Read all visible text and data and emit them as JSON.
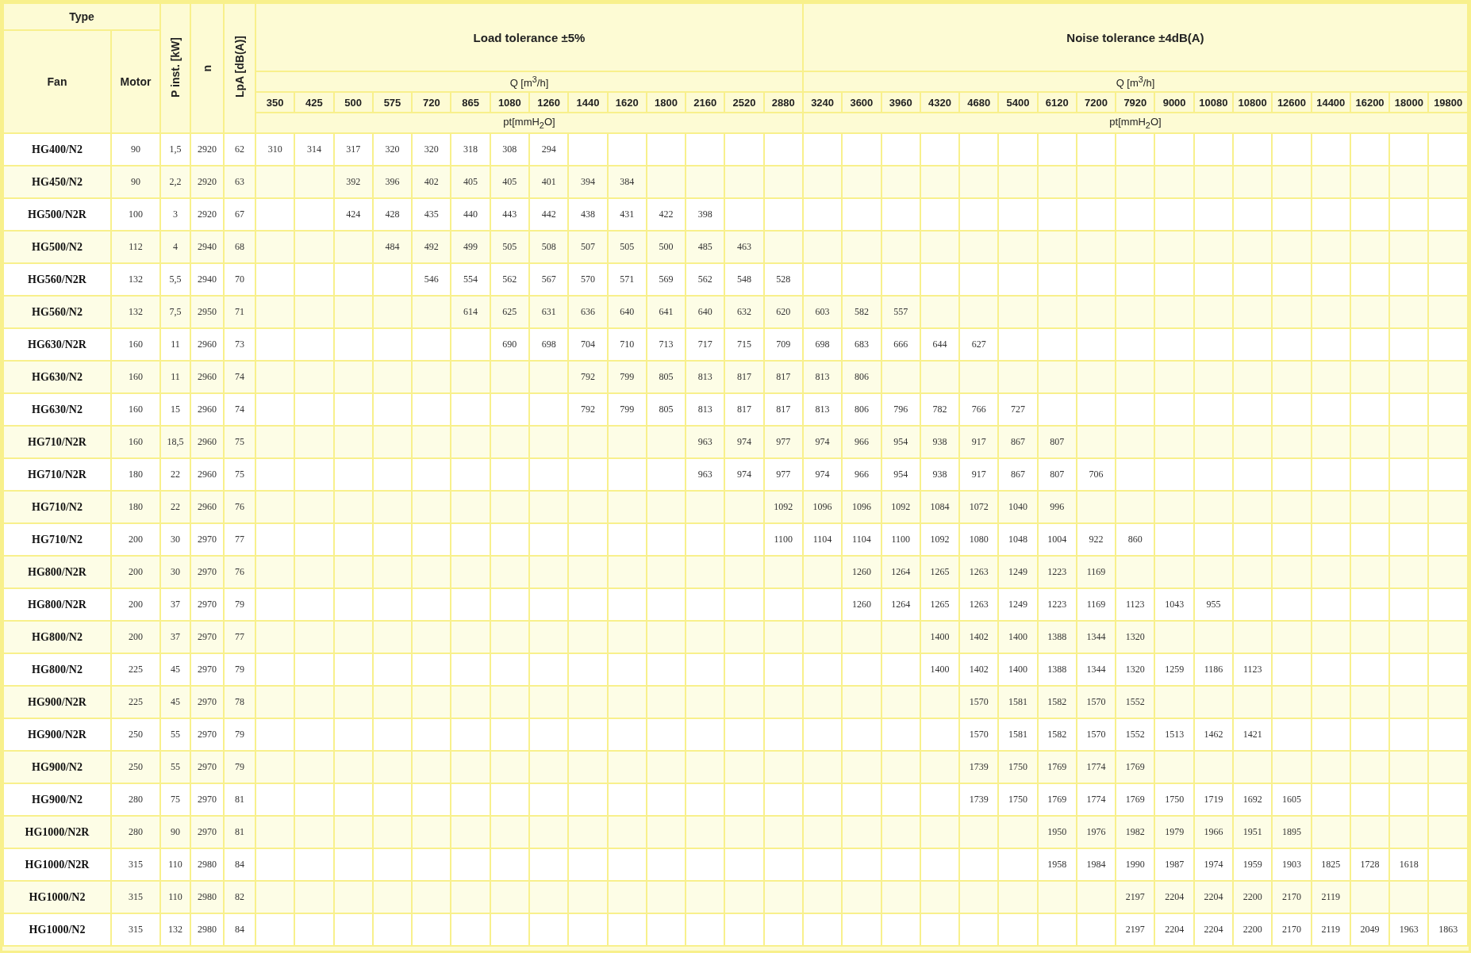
{
  "header": {
    "type": "Type",
    "fan": "Fan",
    "motor": "Motor",
    "p_inst": "P inst. [kW]",
    "n": "n",
    "lpa": "LpA [dB(A)]",
    "groups": [
      {
        "title": "Load tolerance ±5%",
        "q_label": "Q [m$^{3}$/h]",
        "pt_label": "pt[mmH$_{2}$O]",
        "q_values": [
          "350",
          "425",
          "500",
          "575",
          "720",
          "865",
          "1080",
          "1260",
          "1440",
          "1620",
          "1800",
          "2160",
          "2520",
          "2880"
        ]
      },
      {
        "title": "Noise tolerance ±4dB(A)",
        "q_label": "Q [m$^{3}$/h]",
        "pt_label": "pt[mmH$_{2}$O]",
        "q_values": [
          "3240",
          "3600",
          "3960",
          "4320",
          "4680",
          "5400",
          "6120",
          "7200",
          "7920",
          "9000",
          "10080",
          "10800",
          "12600",
          "14400",
          "16200",
          "18000",
          "19800"
        ]
      }
    ]
  },
  "rows": [
    {
      "fan": "HG400/N2",
      "motor": "90",
      "p_inst": "1,5",
      "n": "2920",
      "lpa": "62",
      "lead_blanks": [],
      "pt": [
        "310",
        "314",
        "317",
        "320",
        "320",
        "318",
        "308",
        "294"
      ]
    },
    {
      "fan": "HG450/N2",
      "motor": "90",
      "p_inst": "2,2",
      "n": "2920",
      "lpa": "63",
      "lead_blanks": [
        {
          "kind": "blank"
        },
        {
          "kind": "blank"
        }
      ],
      "pt": [
        "392",
        "396",
        "402",
        "405",
        "405",
        "401",
        "394",
        "384"
      ]
    },
    {
      "fan": "HG500/N2R",
      "motor": "100",
      "p_inst": "3",
      "n": "2920",
      "lpa": "67",
      "lead_blanks": [
        {
          "kind": "blank"
        },
        {
          "kind": "blank"
        }
      ],
      "pt": [
        "424",
        "428",
        "435",
        "440",
        "443",
        "442",
        "438",
        "431",
        "422",
        "398"
      ]
    },
    {
      "fan": "HG500/N2",
      "motor": "112",
      "p_inst": "4",
      "n": "2940",
      "lpa": "68",
      "lead_blanks": [
        {
          "kind": "blank"
        },
        {
          "kind": "blank"
        },
        {
          "kind": "blank"
        }
      ],
      "pt": [
        "484",
        "492",
        "499",
        "505",
        "508",
        "507",
        "505",
        "500",
        "485",
        "463"
      ]
    },
    {
      "fan": "HG560/N2R",
      "motor": "132",
      "p_inst": "5,5",
      "n": "2940",
      "lpa": "70",
      "lead_blanks": [
        {
          "kind": "blank"
        },
        {
          "kind": "blank"
        },
        {
          "kind": "blank"
        },
        {
          "kind": "blank"
        }
      ],
      "pt": [
        "546",
        "554",
        "562",
        "567",
        "570",
        "571",
        "569",
        "562",
        "548",
        "528"
      ]
    },
    {
      "fan": "HG560/N2",
      "motor": "132",
      "p_inst": "7,5",
      "n": "2950",
      "lpa": "71",
      "lead_blanks": [
        {
          "kind": "blank"
        },
        {
          "kind": "blank"
        },
        {
          "kind": "blank"
        },
        {
          "kind": "blank"
        },
        {
          "kind": "blank"
        }
      ],
      "pt": [
        "614",
        "625",
        "631",
        "636",
        "640",
        "641",
        "640",
        "632",
        "620",
        "603",
        "582",
        "557"
      ]
    },
    {
      "fan": "HG630/N2R",
      "motor": "160",
      "p_inst": "11",
      "n": "2960",
      "lpa": "73",
      "lead_blanks": [
        {
          "kind": "blank"
        },
        {
          "kind": "blank"
        },
        {
          "kind": "blank"
        },
        {
          "kind": "blank"
        },
        {
          "kind": "blank"
        },
        {
          "kind": "blank"
        }
      ],
      "pt": [
        "690",
        "698",
        "704",
        "710",
        "713",
        "717",
        "715",
        "709",
        "698",
        "683",
        "666",
        "644",
        "627"
      ]
    },
    {
      "fan": "HG630/N2",
      "motor": "160",
      "p_inst": "11",
      "n": "2960",
      "lpa": "74",
      "lead_blanks": [
        {
          "kind": "blank"
        },
        {
          "kind": "blank"
        },
        {
          "kind": "blank"
        },
        {
          "kind": "blank"
        },
        {
          "kind": "blank"
        },
        {
          "kind": "blank"
        },
        {
          "kind": "blank"
        },
        {
          "kind": "blank"
        }
      ],
      "pt": [
        "792",
        "799",
        "805",
        "813",
        "817",
        "817",
        "813",
        "806"
      ]
    },
    {
      "fan": "HG630/N2",
      "motor": "160",
      "p_inst": "15",
      "n": "2960",
      "lpa": "74",
      "lead_blanks": [
        {
          "kind": "blank"
        },
        {
          "kind": "blank"
        },
        {
          "kind": "blank"
        },
        {
          "kind": "blank"
        },
        {
          "kind": "blank"
        },
        {
          "kind": "blank"
        },
        {
          "kind": "blank"
        },
        {
          "kind": "blank"
        }
      ],
      "pt": [
        "792",
        "799",
        "805",
        "813",
        "817",
        "817",
        "813",
        "806",
        "796",
        "782",
        "766",
        "727"
      ]
    },
    {
      "fan": "HG710/N2R",
      "motor": "160",
      "p_inst": "18,5",
      "n": "2960",
      "lpa": "75",
      "lead_blanks": [
        {
          "kind": "blank"
        },
        {
          "kind": "blank"
        },
        {
          "kind": "blank"
        },
        {
          "kind": "blank"
        },
        {
          "kind": "blank"
        },
        {
          "kind": "blank"
        },
        {
          "kind": "blank"
        },
        {
          "kind": "blank"
        },
        {
          "kind": "blank"
        },
        {
          "kind": "blank"
        },
        {
          "kind": "blank"
        }
      ],
      "pt": [
        "963",
        "974",
        "977",
        "974",
        "966",
        "954",
        "938",
        "917",
        "867",
        "807"
      ]
    },
    {
      "fan": "HG710/N2R",
      "motor": "180",
      "p_inst": "22",
      "n": "2960",
      "lpa": "75",
      "lead_blanks": [
        {
          "kind": "blank"
        },
        {
          "kind": "blank"
        },
        {
          "kind": "blank"
        },
        {
          "kind": "blank"
        },
        {
          "kind": "blank"
        },
        {
          "kind": "blank"
        },
        {
          "kind": "blank"
        },
        {
          "kind": "blank"
        },
        {
          "kind": "blank"
        },
        {
          "kind": "blank"
        },
        {
          "kind": "blank"
        }
      ],
      "pt": [
        "963",
        "974",
        "977",
        "974",
        "966",
        "954",
        "938",
        "917",
        "867",
        "807",
        "706"
      ]
    },
    {
      "fan": "HG710/N2",
      "motor": "180",
      "p_inst": "22",
      "n": "2960",
      "lpa": "76",
      "lead_blanks": [
        {
          "kind": "blank"
        },
        {
          "kind": "blank"
        },
        {
          "kind": "blank"
        },
        {
          "kind": "blank"
        },
        {
          "kind": "blank"
        },
        {
          "kind": "blank"
        },
        {
          "kind": "blank"
        },
        {
          "kind": "blank"
        },
        {
          "kind": "blank"
        },
        {
          "kind": "blank"
        },
        {
          "kind": "blank"
        },
        {
          "kind": "blank"
        },
        {
          "kind": "blank"
        }
      ],
      "pt": [
        "1092",
        "1096",
        "1096",
        "1092",
        "1084",
        "1072",
        "1040",
        "996"
      ]
    },
    {
      "fan": "HG710/N2",
      "motor": "200",
      "p_inst": "30",
      "n": "2970",
      "lpa": "77",
      "lead_blanks": [
        {
          "kind": "blank"
        },
        {
          "kind": "blank"
        },
        {
          "kind": "blank"
        },
        {
          "kind": "blank"
        },
        {
          "kind": "blank"
        },
        {
          "kind": "blank"
        },
        {
          "kind": "blank"
        },
        {
          "kind": "blank"
        },
        {
          "kind": "blank"
        },
        {
          "kind": "blank"
        },
        {
          "kind": "blank"
        },
        {
          "kind": "blank"
        },
        {
          "kind": "blank"
        }
      ],
      "pt": [
        "1100",
        "1104",
        "1104",
        "1100",
        "1092",
        "1080",
        "1048",
        "1004",
        "922",
        "860"
      ]
    },
    {
      "fan": "HG800/N2R",
      "motor": "200",
      "p_inst": "30",
      "n": "2970",
      "lpa": "76",
      "lead_blanks": [
        {
          "kind": "blank"
        },
        {
          "kind": "blank"
        },
        {
          "kind": "blank"
        },
        {
          "kind": "blank"
        },
        {
          "kind": "blank"
        },
        {
          "kind": "blank"
        },
        {
          "kind": "blank"
        },
        {
          "kind": "blank"
        },
        {
          "kind": "blank"
        },
        {
          "kind": "blank"
        },
        {
          "kind": "blank"
        },
        {
          "kind": "blank"
        },
        {
          "kind": "blank"
        },
        {
          "kind": "blank"
        },
        {
          "kind": "blank"
        }
      ],
      "pt": [
        "1260",
        "1264",
        "1265",
        "1263",
        "1249",
        "1223",
        "1169"
      ]
    },
    {
      "fan": "HG800/N2R",
      "motor": "200",
      "p_inst": "37",
      "n": "2970",
      "lpa": "79",
      "lead_blanks": [
        {
          "kind": "blank"
        },
        {
          "kind": "blank"
        },
        {
          "kind": "blank"
        },
        {
          "kind": "blank"
        },
        {
          "kind": "blank"
        },
        {
          "kind": "blank"
        },
        {
          "kind": "blank"
        },
        {
          "kind": "blank"
        },
        {
          "kind": "blank"
        },
        {
          "kind": "blank"
        },
        {
          "kind": "blank"
        },
        {
          "kind": "blank"
        },
        {
          "kind": "blank"
        },
        {
          "kind": "blank"
        },
        {
          "kind": "blank"
        }
      ],
      "pt": [
        "1260",
        "1264",
        "1265",
        "1263",
        "1249",
        "1223",
        "1169",
        "1123",
        "1043",
        "955"
      ]
    },
    {
      "fan": "HG800/N2",
      "motor": "200",
      "p_inst": "37",
      "n": "2970",
      "lpa": "77",
      "lead_blanks": [
        {
          "kind": "blank"
        },
        {
          "kind": "blank"
        },
        {
          "kind": "blank"
        },
        {
          "kind": "blank"
        },
        {
          "kind": "blank"
        },
        {
          "kind": "blank"
        },
        {
          "kind": "blank"
        },
        {
          "kind": "blank"
        },
        {
          "kind": "blank"
        },
        {
          "kind": "blank"
        },
        {
          "kind": "blank"
        },
        {
          "kind": "blank"
        },
        {
          "kind": "blank"
        },
        {
          "kind": "blank"
        },
        {
          "kind": "blank"
        },
        {
          "kind": "blank"
        },
        {
          "kind": "blank"
        }
      ],
      "pt": [
        "1400",
        "1402",
        "1400",
        "1388",
        "1344",
        "1320"
      ]
    },
    {
      "fan": "HG800/N2",
      "motor": "225",
      "p_inst": "45",
      "n": "2970",
      "lpa": "79",
      "lead_blanks": [
        {
          "kind": "blank"
        },
        {
          "kind": "blank"
        },
        {
          "kind": "blank"
        },
        {
          "kind": "blank"
        },
        {
          "kind": "blank"
        },
        {
          "kind": "blank"
        },
        {
          "kind": "blank"
        },
        {
          "kind": "blank"
        },
        {
          "kind": "blank"
        },
        {
          "kind": "blank"
        },
        {
          "kind": "blank"
        },
        {
          "kind": "blank"
        },
        {
          "kind": "blank"
        },
        {
          "kind": "blank"
        },
        {
          "kind": "blank"
        },
        {
          "kind": "blank"
        },
        {
          "kind": "blank"
        }
      ],
      "pt": [
        "1400",
        "1402",
        "1400",
        "1388",
        "1344",
        "1320",
        "1259",
        "1186",
        "1123"
      ]
    },
    {
      "fan": "HG900/N2R",
      "motor": "225",
      "p_inst": "45",
      "n": "2970",
      "lpa": "78",
      "lead_blanks": [
        {
          "kind": "blank"
        },
        {
          "kind": "blank"
        },
        {
          "kind": "blank"
        },
        {
          "kind": "blank"
        },
        {
          "kind": "blank"
        },
        {
          "kind": "blank"
        },
        {
          "kind": "blank"
        },
        {
          "kind": "blank"
        },
        {
          "kind": "blank"
        },
        {
          "kind": "blank"
        },
        {
          "kind": "blank"
        },
        {
          "kind": "blank"
        },
        {
          "kind": "blank"
        },
        {
          "kind": "blank"
        },
        {
          "kind": "blank"
        },
        {
          "kind": "blank"
        },
        {
          "kind": "blank"
        },
        {
          "kind": "blank"
        }
      ],
      "pt": [
        "1570",
        "1581",
        "1582",
        "1570",
        "1552"
      ]
    },
    {
      "fan": "HG900/N2R",
      "motor": "250",
      "p_inst": "55",
      "n": "2970",
      "lpa": "79",
      "lead_blanks": [
        {
          "kind": "blank"
        },
        {
          "kind": "blank"
        },
        {
          "kind": "blank"
        },
        {
          "kind": "blank"
        },
        {
          "kind": "blank"
        },
        {
          "kind": "blank"
        },
        {
          "kind": "blank"
        },
        {
          "kind": "blank"
        },
        {
          "kind": "blank"
        },
        {
          "kind": "blank"
        },
        {
          "kind": "blank"
        },
        {
          "kind": "blank"
        },
        {
          "kind": "blank"
        },
        {
          "kind": "blank"
        },
        {
          "kind": "blank"
        },
        {
          "kind": "blank"
        },
        {
          "kind": "blank"
        },
        {
          "kind": "blank"
        }
      ],
      "pt": [
        "1570",
        "1581",
        "1582",
        "1570",
        "1552",
        "1513",
        "1462",
        "1421"
      ]
    },
    {
      "fan": "HG900/N2",
      "motor": "250",
      "p_inst": "55",
      "n": "2970",
      "lpa": "79",
      "lead_blanks": [
        {
          "kind": "blank"
        },
        {
          "kind": "blank"
        },
        {
          "kind": "blank"
        },
        {
          "kind": "blank"
        },
        {
          "kind": "blank"
        },
        {
          "kind": "blank"
        },
        {
          "kind": "blank"
        },
        {
          "kind": "blank"
        },
        {
          "kind": "blank"
        },
        {
          "kind": "blank"
        },
        {
          "kind": "blank"
        },
        {
          "kind": "blank"
        },
        {
          "kind": "blank"
        },
        {
          "kind": "blank"
        },
        {
          "kind": "blank"
        },
        {
          "kind": "blank"
        },
        {
          "kind": "blank"
        },
        {
          "kind": "blank"
        }
      ],
      "pt": [
        "1739",
        "1750",
        "1769",
        "1774",
        "1769"
      ]
    },
    {
      "fan": "HG900/N2",
      "motor": "280",
      "p_inst": "75",
      "n": "2970",
      "lpa": "81",
      "lead_blanks": [
        {
          "kind": "blank"
        },
        {
          "kind": "blank"
        },
        {
          "kind": "blank"
        },
        {
          "kind": "blank"
        },
        {
          "kind": "blank"
        },
        {
          "kind": "blank"
        },
        {
          "kind": "blank"
        },
        {
          "kind": "blank"
        },
        {
          "kind": "blank"
        },
        {
          "kind": "blank"
        },
        {
          "kind": "blank"
        },
        {
          "kind": "blank"
        },
        {
          "kind": "blank"
        },
        {
          "kind": "blank"
        },
        {
          "kind": "blank"
        },
        {
          "kind": "blank"
        },
        {
          "kind": "blank"
        },
        {
          "kind": "blank"
        }
      ],
      "pt": [
        "1739",
        "1750",
        "1769",
        "1774",
        "1769",
        "1750",
        "1719",
        "1692",
        "1605"
      ]
    },
    {
      "fan": "HG1000/N2R",
      "motor": "280",
      "p_inst": "90",
      "n": "2970",
      "lpa": "81",
      "lead_blanks": [
        {
          "kind": "blank"
        },
        {
          "kind": "blank"
        },
        {
          "kind": "blank"
        },
        {
          "kind": "blank"
        },
        {
          "kind": "blank"
        },
        {
          "kind": "blank"
        },
        {
          "kind": "blank"
        },
        {
          "kind": "blank"
        },
        {
          "kind": "blank"
        },
        {
          "kind": "blank"
        },
        {
          "kind": "blank"
        },
        {
          "kind": "blank"
        },
        {
          "kind": "blank"
        },
        {
          "kind": "blank"
        },
        {
          "kind": "blank"
        },
        {
          "kind": "blank"
        },
        {
          "kind": "blank"
        },
        {
          "kind": "blank"
        },
        {
          "kind": "blank"
        },
        {
          "kind": "blank"
        }
      ],
      "pt": [
        "1950",
        "1976",
        "1982",
        "1979",
        "1966",
        "1951",
        "1895"
      ]
    },
    {
      "fan": "HG1000/N2R",
      "motor": "315",
      "p_inst": "110",
      "n": "2980",
      "lpa": "84",
      "lead_blanks": [
        {
          "kind": "blank"
        },
        {
          "kind": "blank"
        },
        {
          "kind": "blank"
        },
        {
          "kind": "blank"
        },
        {
          "kind": "blank"
        },
        {
          "kind": "blank"
        },
        {
          "kind": "blank"
        },
        {
          "kind": "blank"
        },
        {
          "kind": "blank"
        },
        {
          "kind": "blank"
        },
        {
          "kind": "blank"
        },
        {
          "kind": "blank"
        },
        {
          "kind": "blank"
        },
        {
          "kind": "blank"
        },
        {
          "kind": "blank"
        },
        {
          "kind": "blank"
        },
        {
          "kind": "blank"
        },
        {
          "kind": "blank"
        },
        {
          "kind": "blank"
        },
        {
          "kind": "blank"
        }
      ],
      "pt": [
        "1958",
        "1984",
        "1990",
        "1987",
        "1974",
        "1959",
        "1903",
        "1825",
        "1728",
        "1618"
      ]
    },
    {
      "fan": "HG1000/N2",
      "motor": "315",
      "p_inst": "110",
      "n": "2980",
      "lpa": "82",
      "lead_blanks": [
        {
          "kind": "blank"
        },
        {
          "kind": "blank"
        },
        {
          "kind": "blank"
        },
        {
          "kind": "blank"
        },
        {
          "kind": "blank"
        },
        {
          "kind": "blank"
        },
        {
          "kind": "blank"
        },
        {
          "kind": "blank"
        },
        {
          "kind": "blank"
        },
        {
          "kind": "blank"
        },
        {
          "kind": "blank"
        },
        {
          "kind": "blank"
        },
        {
          "kind": "blank"
        },
        {
          "kind": "blank"
        },
        {
          "kind": "blank"
        },
        {
          "kind": "blank"
        },
        {
          "kind": "blank"
        },
        {
          "kind": "blank"
        },
        {
          "kind": "blank"
        },
        {
          "kind": "blank"
        },
        {
          "kind": "blank"
        },
        {
          "kind": "blank"
        }
      ],
      "pt": [
        "2197",
        "2204",
        "2204",
        "2200",
        "2170",
        "2119"
      ]
    },
    {
      "fan": "HG1000/N2",
      "motor": "315",
      "p_inst": "132",
      "n": "2980",
      "lpa": "84",
      "lead_blanks": [
        {
          "kind": "blank"
        },
        {
          "kind": "blank"
        },
        {
          "kind": "blank"
        },
        {
          "kind": "blank"
        },
        {
          "kind": "blank"
        },
        {
          "kind": "blank"
        },
        {
          "kind": "blank"
        },
        {
          "kind": "blank"
        },
        {
          "kind": "blank"
        },
        {
          "kind": "blank"
        },
        {
          "kind": "blank"
        },
        {
          "kind": "blank"
        },
        {
          "kind": "blank"
        },
        {
          "kind": "blank"
        },
        {
          "kind": "blank"
        },
        {
          "kind": "blank"
        },
        {
          "kind": "blank"
        },
        {
          "kind": "blank"
        },
        {
          "kind": "blank"
        },
        {
          "kind": "blank"
        },
        {
          "kind": "blank"
        },
        {
          "kind": "blank"
        }
      ],
      "pt": [
        "2197",
        "2204",
        "2204",
        "2200",
        "2170",
        "2119",
        "2049",
        "1963",
        "1863"
      ]
    }
  ]
}
